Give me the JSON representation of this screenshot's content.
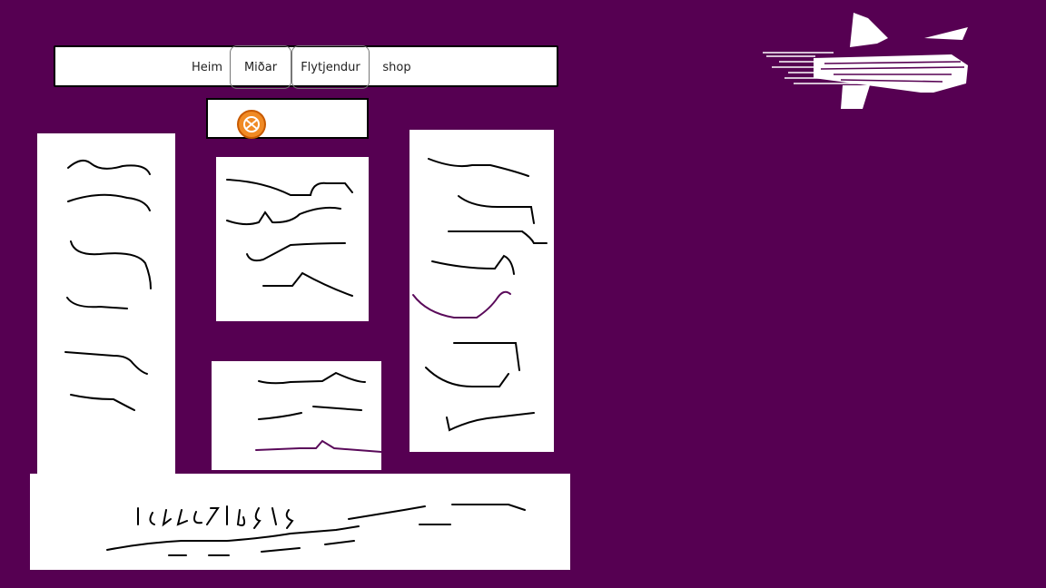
{
  "colors": {
    "background": "#560052",
    "panel": "#ffffff",
    "ink": "#000000",
    "accent_line": "#5a0a5a",
    "logo": "#f08a24"
  },
  "nav": {
    "items": [
      {
        "label": "Heim"
      },
      {
        "label": "Miðar"
      },
      {
        "label": "Flytjendur"
      },
      {
        "label": "shop"
      }
    ]
  },
  "logo": {
    "icon": "orange-badge-icon"
  },
  "footer": {
    "icon": "handwritten-text"
  },
  "decor": {
    "icon": "white-airplane-icon"
  }
}
